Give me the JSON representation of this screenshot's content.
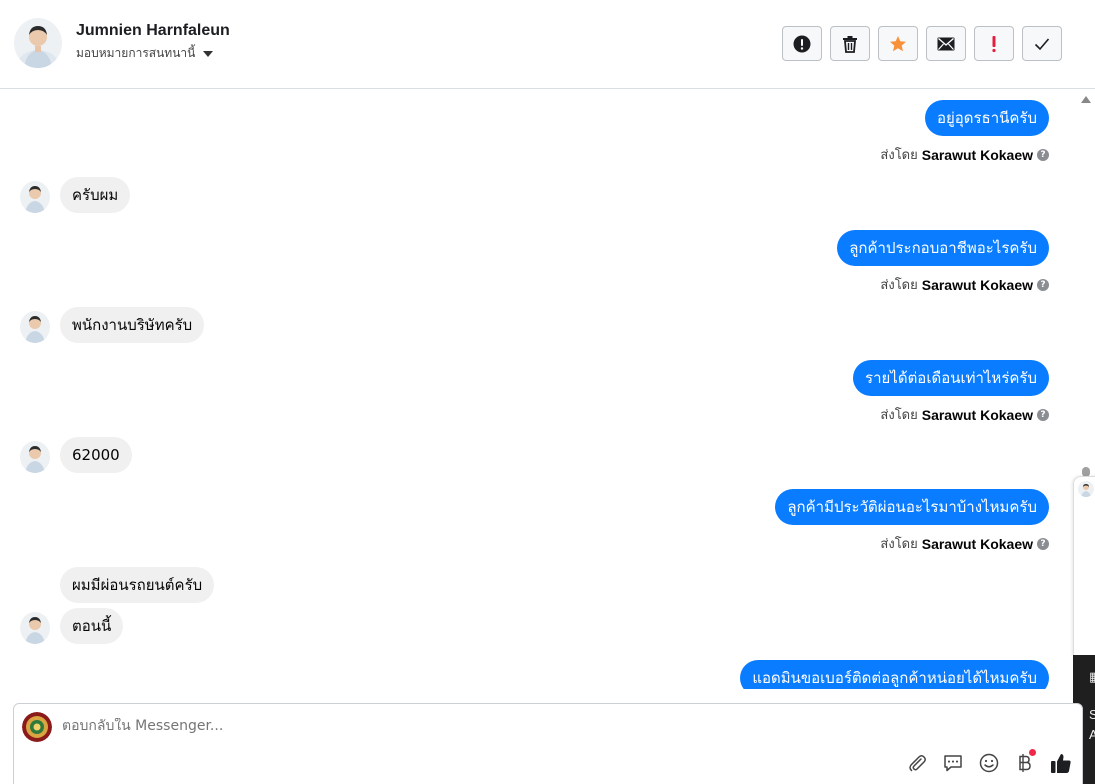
{
  "header": {
    "contact_name": "Jumnien Harnfaleun",
    "assign_label": "มอบหมายการสนทนานี้"
  },
  "toolbar": {
    "buttons": [
      {
        "name": "report-spam-button",
        "icon": "exclamation-circle-icon"
      },
      {
        "name": "delete-button",
        "icon": "trash-icon"
      },
      {
        "name": "star-button",
        "icon": "star-icon",
        "color": "#f7923a"
      },
      {
        "name": "mark-unread-button",
        "icon": "envelope-icon"
      },
      {
        "name": "follow-up-button",
        "icon": "exclamation-icon",
        "color": "#e41e3f"
      },
      {
        "name": "mark-done-button",
        "icon": "check-icon"
      }
    ]
  },
  "messages": {
    "m1": {
      "text": "อยู่อุดรธานีครับ",
      "sent_by_prefix": "ส่งโดย",
      "sender": "Sarawut Kokaew"
    },
    "m2": {
      "text": "ครับผม"
    },
    "m3": {
      "text": "ลูกค้าประกอบอาชีพอะไรครับ",
      "sent_by_prefix": "ส่งโดย",
      "sender": "Sarawut Kokaew"
    },
    "m4": {
      "text": "พนักงานบริษัทครับ"
    },
    "m5": {
      "text": "รายได้ต่อเดือนเท่าไหร่ครับ",
      "sent_by_prefix": "ส่งโดย",
      "sender": "Sarawut Kokaew"
    },
    "m6": {
      "text": "62000"
    },
    "m7": {
      "text": "ลูกค้ามีประวัติผ่อนอะไรมาบ้างไหมครับ",
      "sent_by_prefix": "ส่งโดย",
      "sender": "Sarawut Kokaew"
    },
    "m8": {
      "text": "ผมมีผ่อนรถยนต์ครับ"
    },
    "m9": {
      "text": "ตอนนี้"
    },
    "m10": {
      "text": "แอดมินขอเบอร์ติดต่อลูกค้าหน่อยได้ไหมครับ"
    }
  },
  "composer": {
    "placeholder": "ตอบกลับใน Messenger..."
  },
  "side_panel": {
    "lines": [
      "S",
      "A"
    ]
  },
  "colors": {
    "outgoing_bubble": "#0a7cff",
    "incoming_bubble": "#f0f0f0",
    "accent_red": "#f02849"
  }
}
